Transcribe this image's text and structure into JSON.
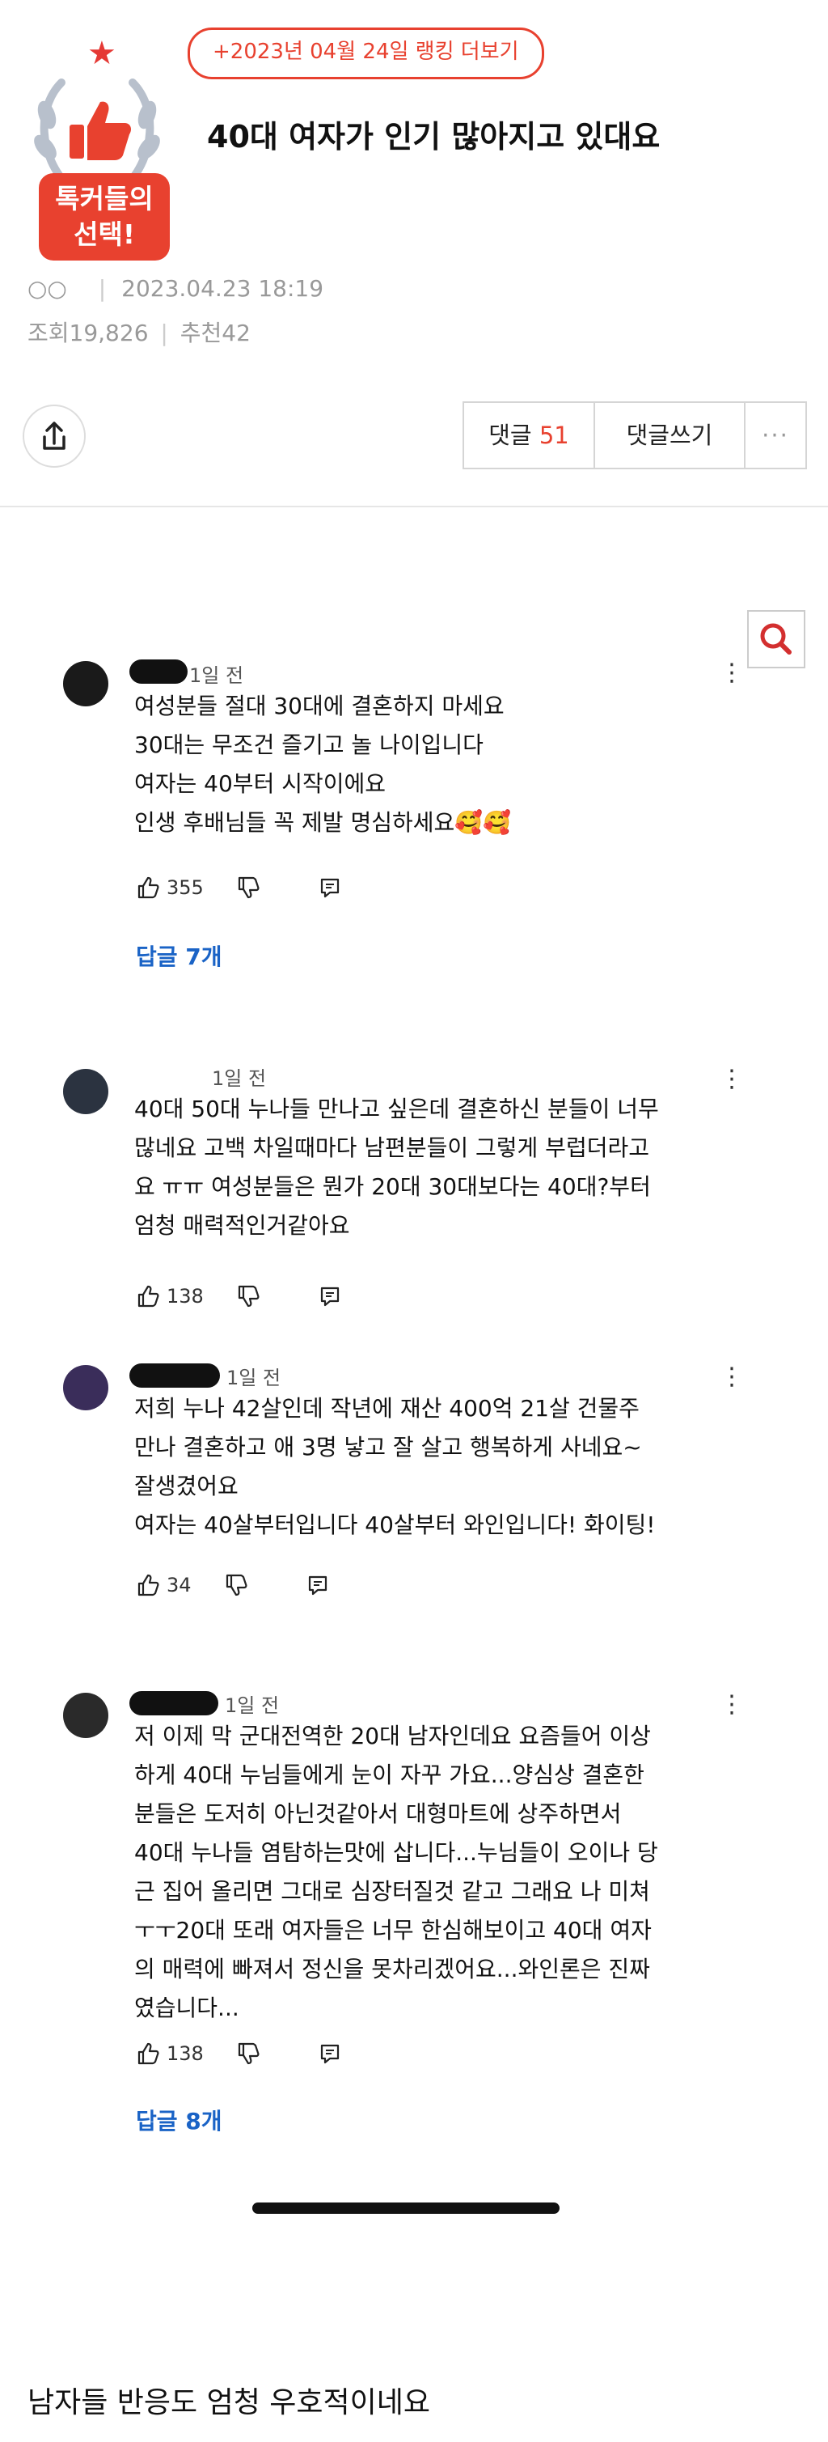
{
  "header": {
    "rank_link": "+2023년 04월 24일 랭킹 더보기",
    "title": "40대 여자가 인기 많아지고 있대요",
    "badge_line1": "톡커들의",
    "badge_line2": "선택!",
    "author": "○○",
    "date": "2023.04.23 18:19",
    "views_label": "조회",
    "views": "19,826",
    "recs_label": "추천",
    "recs": "42",
    "comments_label": "댓글",
    "comments_count": "51",
    "write_comment": "댓글쓰기",
    "more": "···"
  },
  "comments": [
    {
      "time": "1일 전",
      "text": "여성분들 절대 30대에 결혼하지 마세요\n30대는 무조건 즐기고 놀 나이입니다\n여자는 40부터 시작이에요\n인생 후배님들 꼭 제발 명심하세요🥰🥰",
      "likes": "355",
      "replies": "답글 7개"
    },
    {
      "time": "1일 전",
      "text": "40대 50대 누나들 만나고 싶은데 결혼하신 분들이 너무\n많네요 고백 차일때마다 남편분들이 그렇게 부럽더라고\n요 ㅠㅠ 여성분들은 뭔가 20대 30대보다는 40대?부터\n엄청 매력적인거같아요",
      "likes": "138",
      "replies": ""
    },
    {
      "time": "1일 전",
      "text": "저희 누나 42살인데 작년에 재산 400억 21살 건물주\n만나 결혼하고 애 3명 낳고 잘 살고 행복하게 사네요~\n잘생겼어요\n여자는 40살부터입니다 40살부터 와인입니다! 화이팅!",
      "likes": "34",
      "replies": ""
    },
    {
      "time": "1일 전",
      "text": "저 이제 막 군대전역한 20대 남자인데요 요즘들어 이상\n하게 40대 누님들에게 눈이 자꾸 가요...양심상 결혼한\n분들은 도저히 아닌것같아서 대형마트에 상주하면서\n40대 누나들 염탐하는맛에 삽니다...누님들이 오이나 당\n근 집어 올리면 그대로 심장터질것 같고 그래요 나 미쳐\nㅜㅜ20대 또래 여자들은 너무 한심해보이고 40대 여자\n의 매력에 빠져서 정신을 못차리겠어요...와인론은 진짜\n였습니다...",
      "likes": "138",
      "replies": "답글 8개"
    }
  ],
  "footer": {
    "text": "남자들 반응도 엄청 우호적이네요"
  }
}
